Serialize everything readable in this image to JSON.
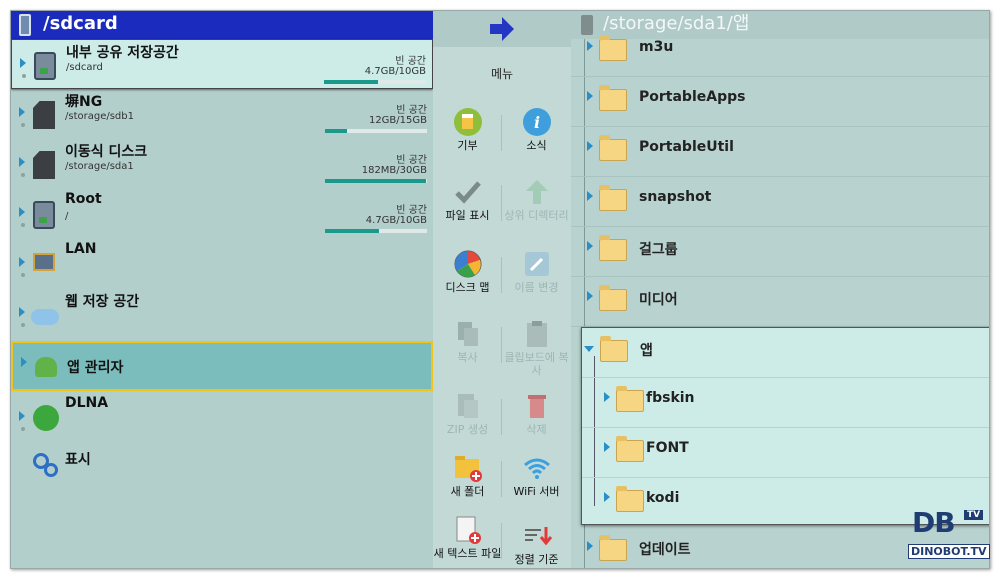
{
  "left": {
    "header_title": "/sdcard",
    "items": [
      {
        "name": "내부 공유 저장공간",
        "path": "/sdcard",
        "free_label": "빈 공간",
        "size": "4.7GB/10GB",
        "used_fraction": 0.53
      },
      {
        "name": "塀NG",
        "path": "/storage/sdb1",
        "free_label": "빈 공간",
        "size": "12GB/15GB",
        "used_fraction": 0.22
      },
      {
        "name": "이동식 디스크",
        "path": "/storage/sda1",
        "free_label": "빈 공간",
        "size": "182MB/30GB",
        "used_fraction": 0.99
      },
      {
        "name": "Root",
        "path": "/",
        "free_label": "빈 공간",
        "size": "4.7GB/10GB",
        "used_fraction": 0.53
      },
      {
        "name": "LAN"
      },
      {
        "name": "웹 저장 공간"
      },
      {
        "name": "앱 관리자"
      },
      {
        "name": "DLNA"
      },
      {
        "name": "표시"
      }
    ]
  },
  "menu": {
    "title": "메뉴",
    "buttons": [
      {
        "label": "기부",
        "enabled": true
      },
      {
        "label": "소식",
        "enabled": true
      },
      {
        "label": "파일 표시",
        "enabled": true
      },
      {
        "label": "상위 디렉터리",
        "enabled": false
      },
      {
        "label": "디스크 맵",
        "enabled": true
      },
      {
        "label": "이름 변경",
        "enabled": false
      },
      {
        "label": "복사",
        "enabled": false
      },
      {
        "label": "클립보드에 복사",
        "enabled": false
      },
      {
        "label": "ZIP 생성",
        "enabled": false
      },
      {
        "label": "삭제",
        "enabled": false
      },
      {
        "label": "새 폴더",
        "enabled": true
      },
      {
        "label": "WiFi 서버",
        "enabled": true
      },
      {
        "label": "새 텍스트 파일",
        "enabled": true
      },
      {
        "label": "정렬 기준",
        "enabled": true
      }
    ]
  },
  "right": {
    "header_title": "/storage/sda1/앱",
    "folders": [
      "m3u",
      "PortableApps",
      "PortableUtil",
      "snapshot",
      "걸그룹",
      "미디어"
    ],
    "expanded": {
      "name": "앱",
      "children": [
        "fbskin",
        "FONT",
        "kodi"
      ]
    },
    "after": [
      "업데이트"
    ]
  },
  "watermark": {
    "logo": "DB",
    "badge": "TV",
    "text": "DINOBOT.TV"
  },
  "colors": {
    "header_blue": "#1a2bbd",
    "accent_teal": "#1b9a8c",
    "focus_yellow": "#f0c418"
  }
}
